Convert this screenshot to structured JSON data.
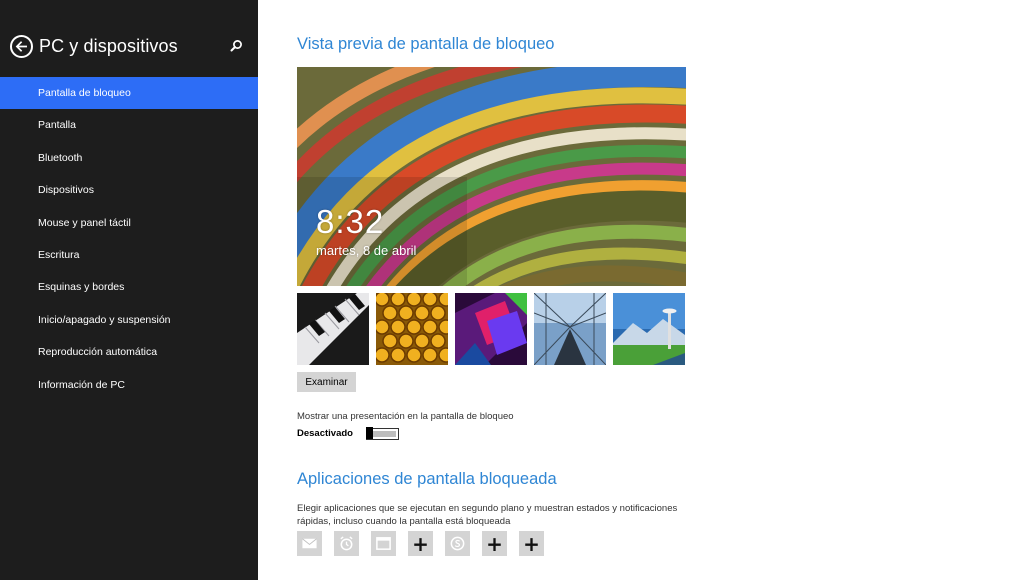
{
  "sidebar": {
    "title": "PC y dispositivos",
    "background": "#1d1d1d",
    "accent": "#2d6df6",
    "items": [
      {
        "label": "Pantalla de bloqueo",
        "active": true
      },
      {
        "label": "Pantalla",
        "active": false
      },
      {
        "label": "Bluetooth",
        "active": false
      },
      {
        "label": "Dispositivos",
        "active": false
      },
      {
        "label": "Mouse y panel táctil",
        "active": false
      },
      {
        "label": "Escritura",
        "active": false
      },
      {
        "label": "Esquinas y bordes",
        "active": false
      },
      {
        "label": "Inicio/apagado y suspensión",
        "active": false
      },
      {
        "label": "Reproducción automática",
        "active": false
      },
      {
        "label": "Información de PC",
        "active": false
      }
    ]
  },
  "main": {
    "heading_color": "#2f86d4",
    "preview_heading": "Vista previa de pantalla de bloqueo",
    "preview": {
      "time": "8:32",
      "date": "martes, 8 de abril"
    },
    "thumbnails": [
      "piano-keys-image",
      "honeycomb-image",
      "geometric-shapes-image",
      "bridge-tunnel-image",
      "space-needle-image"
    ],
    "browse_button": "Examinar",
    "slideshow_label": "Mostrar una presentación en la pantalla de bloqueo",
    "slideshow_state": "Desactivado",
    "apps_heading": "Aplicaciones de pantalla bloqueada",
    "apps_description": "Elegir aplicaciones que se ejecutan en segundo plano y muestran estados y notificaciones rápidas, incluso cuando la pantalla está bloqueada",
    "app_slots": [
      {
        "icon": "mail-icon",
        "type": "app"
      },
      {
        "icon": "alarm-icon",
        "type": "app"
      },
      {
        "icon": "calendar-icon",
        "type": "app"
      },
      {
        "icon": "plus-icon",
        "type": "add",
        "label": "+"
      },
      {
        "icon": "skype-icon",
        "type": "app"
      },
      {
        "icon": "plus-icon",
        "type": "add",
        "label": "+"
      },
      {
        "icon": "plus-icon",
        "type": "add",
        "label": "+"
      }
    ]
  }
}
